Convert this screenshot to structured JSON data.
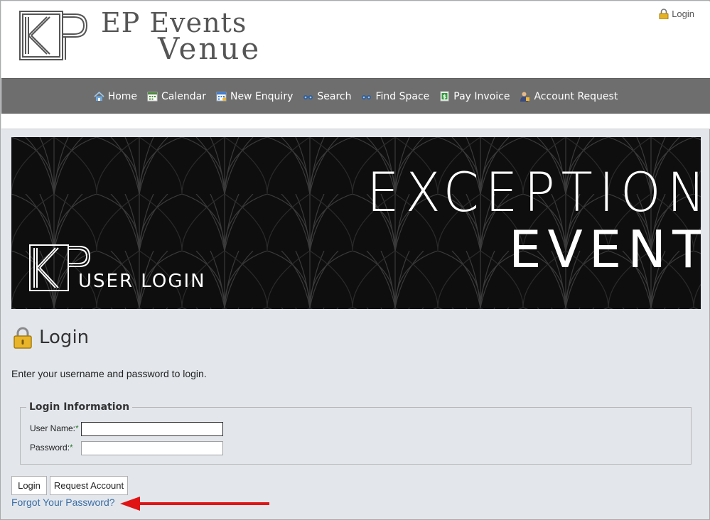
{
  "header": {
    "brand_line1": "EP Events",
    "brand_line2": "Venue",
    "login_link": "Login"
  },
  "nav": {
    "items": [
      {
        "label": "Home",
        "icon": "home-icon"
      },
      {
        "label": "Calendar",
        "icon": "calendar-icon"
      },
      {
        "label": "New Enquiry",
        "icon": "enquiry-icon"
      },
      {
        "label": "Search",
        "icon": "binoculars-icon"
      },
      {
        "label": "Find Space",
        "icon": "binoculars-icon"
      },
      {
        "label": "Pay Invoice",
        "icon": "dollar-icon"
      },
      {
        "label": "Account Request",
        "icon": "user-icon"
      }
    ]
  },
  "banner": {
    "title_line1": "EXCEPTIONAL",
    "title_line2": "EVENTS",
    "subtitle": "USER LOGIN"
  },
  "main": {
    "heading": "Login",
    "intro": "Enter your username and password to login.",
    "fieldset_legend": "Login Information",
    "username_label": "User Name:",
    "password_label": "Password:",
    "required_mark": "*",
    "username_value": "",
    "password_value": "",
    "login_button": "Login",
    "request_button": "Request Account",
    "forgot_link": "Forgot Your Password?"
  },
  "colors": {
    "nav_bg": "#6e6e6e",
    "link": "#3a6ea5",
    "arrow": "#e01414",
    "page_bg": "#e3e7ec"
  }
}
